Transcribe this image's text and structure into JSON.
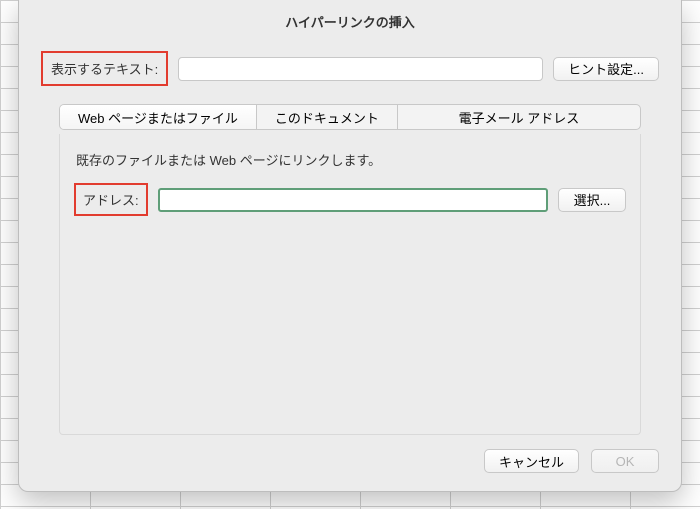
{
  "dialog": {
    "title": "ハイパーリンクの挿入",
    "display_text_label": "表示するテキスト:",
    "display_text_value": "",
    "hint_button": "ヒント設定...",
    "tabs": {
      "web": "Web ページまたはファイル",
      "doc": "このドキュメント",
      "mail": "電子メール アドレス"
    },
    "pane": {
      "description": "既存のファイルまたは Web ページにリンクします。",
      "address_label": "アドレス:",
      "address_value": "",
      "select_button": "選択..."
    },
    "footer": {
      "cancel": "キャンセル",
      "ok": "OK"
    }
  }
}
